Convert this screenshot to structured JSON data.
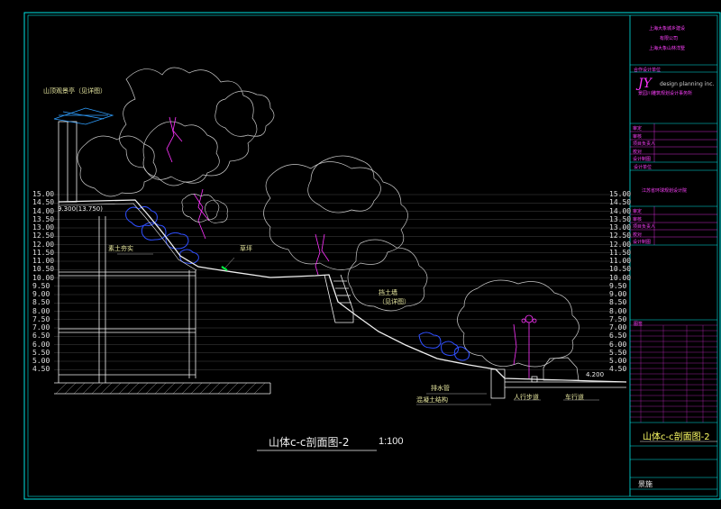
{
  "drawing": {
    "title": "山体c-c剖面图-2",
    "scale": "1:100",
    "elevation_left": "9.300(13.750)",
    "elevation_right": "4.200",
    "annotations": {
      "pavilion": "山顶观景亭（见详图）",
      "fill": "素土夯实",
      "lawn": "草坪",
      "retaining_wall": "挡土墙",
      "retaining_wall_note": "（见详图）",
      "drain": "排水管",
      "concrete": "混凝土结构",
      "sidewalk": "人行步道",
      "roadway": "车行道"
    },
    "levels": [
      "15.00",
      "14.50",
      "14.00",
      "13.50",
      "13.00",
      "12.50",
      "12.00",
      "11.50",
      "11.00",
      "10.50",
      "10.00",
      "9.50",
      "9.00",
      "8.50",
      "8.00",
      "7.50",
      "7.00",
      "6.50",
      "6.00",
      "5.50",
      "5.00",
      "4.50"
    ]
  },
  "title_block": {
    "client_line1": "上海大象城乡建设",
    "client_line2": "有限公司",
    "client_line3": "上海大象山林洋墅",
    "firm_brand": "JY",
    "firm_en": "design planning inc.",
    "firm_cn": "景园川雕筑规划设计事务所",
    "cooperation": "合作设计单位",
    "design_unit": "设计单位",
    "design_unit_name": "江苏省环球规划设计院",
    "rows_a": [
      "审定",
      "审核",
      "项目负责人",
      "校对",
      "设计制图"
    ],
    "rows_b": [
      "审定",
      "审核",
      "项目负责人",
      "校对",
      "设计制图"
    ],
    "table_header": "图签",
    "sheet_title": "山体c-c剖面图-2",
    "discipline": "景施"
  },
  "colors": {
    "frame": "#00e5e5",
    "trees": "#c8c8c8",
    "magenta": "#ff33ff",
    "ground": "#f0f0f0",
    "label": "#ffff66",
    "blue": "#2f4fff"
  }
}
